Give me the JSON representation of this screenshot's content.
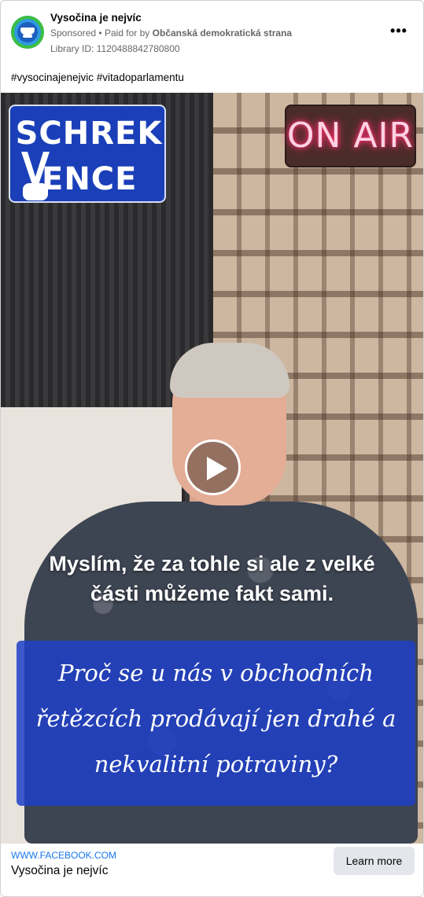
{
  "header": {
    "page_name": "Vysočina je nejvíc",
    "sponsored_label": "Sponsored",
    "paid_for_prefix": "Paid for by",
    "paid_for_name": "Občanská demokratická strana",
    "library_id": "Library ID: 1120488842780800",
    "more_icon": "more-horizontal-icon"
  },
  "post": {
    "hashtags": "#vysocinajenejvic #vitadoparlamentu"
  },
  "video": {
    "logo_line1": "SCHREK",
    "logo_line2": "ENCE",
    "on_air": "ON AIR",
    "play_icon": "play-icon",
    "subtitle": "Myslím, že za tohle si ale z velké části můžeme fakt sami.",
    "question": "Proč se u nás v obchodních řetězcích prodávají jen drahé a nekvalitní potraviny?"
  },
  "footer": {
    "domain": "WWW.FACEBOOK.COM",
    "title": "Vysočina je nejvíc",
    "cta_label": "Learn more"
  },
  "colors": {
    "link_blue": "#1877f2",
    "meta_gray": "#65676b",
    "button_gray": "#e4e6eb"
  }
}
